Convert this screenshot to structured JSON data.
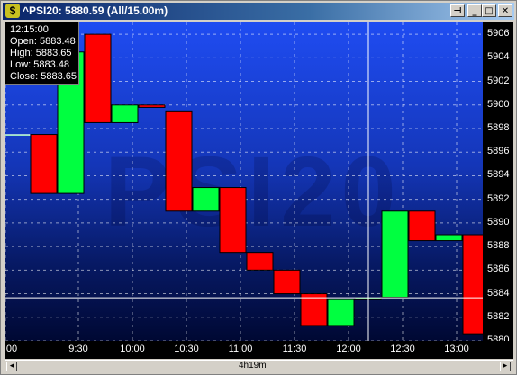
{
  "window": {
    "title": "^PSI20: 5880.59 (All/15.00m)",
    "icon": "dollar-icon",
    "buttons": [
      "pin-icon",
      "minimize-icon",
      "maximize-icon",
      "close-icon"
    ]
  },
  "watermark": "PSI20",
  "info": {
    "time": "12:15:00",
    "open": "Open: 5883.48",
    "high": "High: 5883.65",
    "low": "Low: 5883.48",
    "close": "Close: 5883.65"
  },
  "scrollbar": {
    "label": "4h19m"
  },
  "colors": {
    "up": "#00ff40",
    "down": "#ff0000",
    "background": "#1f4cf2",
    "grid": "#ffffff"
  },
  "chart_data": {
    "type": "candlestick",
    "instrument": "^PSI20",
    "interval": "15.00m",
    "last": 5880.59,
    "ylim": [
      5880,
      5907
    ],
    "yticks": [
      5880,
      5882,
      5884,
      5886,
      5888,
      5890,
      5892,
      5894,
      5896,
      5898,
      5900,
      5902,
      5904,
      5906
    ],
    "ytick_labels": [
      "5880",
      "5882",
      "5884",
      "5886",
      "5888",
      "5890",
      "5892",
      "5894",
      "5896",
      "5898",
      "5900",
      "5902",
      "5904",
      "5906"
    ],
    "xtick_labels": [
      "00",
      "9:30",
      "10:00",
      "10:30",
      "11:00",
      "11:30",
      "12:00",
      "12:30",
      "13:00"
    ],
    "candles": [
      {
        "time": "9:00",
        "open": 5897.5,
        "close": 5897.5
      },
      {
        "time": "9:15",
        "open": 5897.5,
        "close": 5892.5
      },
      {
        "time": "9:30",
        "open": 5892.5,
        "close": 5904.5
      },
      {
        "time": "9:45",
        "open": 5906.0,
        "close": 5898.5
      },
      {
        "time": "10:00",
        "open": 5898.5,
        "close": 5900.0
      },
      {
        "time": "10:15",
        "open": 5900.0,
        "close": 5899.8
      },
      {
        "time": "10:30",
        "open": 5899.5,
        "close": 5891.0
      },
      {
        "time": "10:45",
        "open": 5891.0,
        "close": 5893.0
      },
      {
        "time": "11:00",
        "open": 5893.0,
        "close": 5887.5
      },
      {
        "time": "11:15",
        "open": 5887.5,
        "close": 5886.0
      },
      {
        "time": "11:30",
        "open": 5886.0,
        "close": 5884.0
      },
      {
        "time": "11:45",
        "open": 5884.0,
        "close": 5881.3
      },
      {
        "time": "12:00",
        "open": 5881.3,
        "close": 5883.5
      },
      {
        "time": "12:15",
        "open": 5883.48,
        "close": 5883.65
      },
      {
        "time": "12:30",
        "open": 5883.7,
        "close": 5891.0
      },
      {
        "time": "12:45",
        "open": 5891.0,
        "close": 5888.5
      },
      {
        "time": "13:00",
        "open": 5888.5,
        "close": 5889.0
      },
      {
        "time": "13:15",
        "open": 5889.0,
        "close": 5880.6
      }
    ],
    "crosshair_price": 5883.65,
    "crosshair_time": "12:15",
    "grid": true
  }
}
